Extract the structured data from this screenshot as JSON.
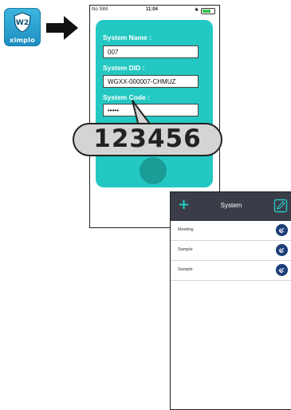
{
  "app_icon": {
    "brand": "ximplo",
    "badge": "W2"
  },
  "status_bar": {
    "carrier": "No SIM",
    "time": "11:04"
  },
  "form": {
    "system_name_label": "System Name :",
    "system_name_value": "007",
    "system_did_label": "System DID :",
    "system_did_value": "WGXX-000007-CHMUZ",
    "system_code_label": "System Code :",
    "system_code_value": "•••••"
  },
  "callout": {
    "code": "123456"
  },
  "system_list": {
    "header_title": "System",
    "items": [
      {
        "label": "Meeting"
      },
      {
        "label": "Sample"
      },
      {
        "label": "Sample"
      }
    ]
  },
  "colors": {
    "teal": "#24c8c2",
    "header_dark": "#3a3d48",
    "link_blue": "#1d3f7a"
  }
}
